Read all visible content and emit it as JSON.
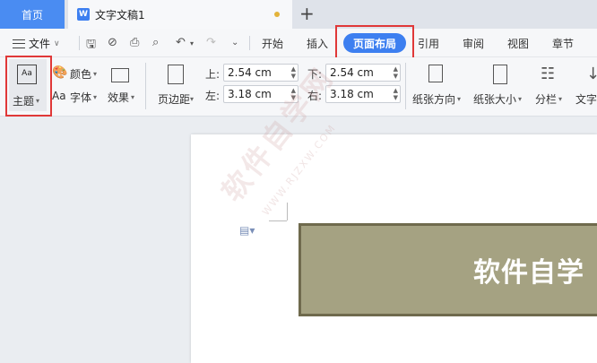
{
  "tabs": {
    "home": "首页",
    "doc_badge": "W",
    "doc_title": "文字文稿1",
    "plus": "+"
  },
  "menu": {
    "file": "文件",
    "tabs": [
      "开始",
      "插入",
      "页面布局",
      "引用",
      "审阅",
      "视图",
      "章节"
    ],
    "active_tab": "页面布局"
  },
  "ribbon": {
    "theme": "主题",
    "theme_icon_text": "Aa",
    "color": "颜色",
    "font_prefix": "Aa",
    "font": "字体",
    "effect": "效果",
    "margins": "页边距",
    "top_label": "上:",
    "top_value": "2.54 cm",
    "left_label": "左:",
    "left_value": "3.18 cm",
    "bottom_label": "下:",
    "bottom_value": "2.54 cm",
    "right_label": "右:",
    "right_value": "3.18 cm",
    "orientation": "纸张方向",
    "size": "纸张大小",
    "columns": "分栏",
    "text_dir": "文字"
  },
  "document": {
    "banner_text": "软件自学",
    "watermark": "软件自学网",
    "watermark_sub": "WWW.RJZXW.COM"
  },
  "colors": {
    "accent": "#3d7ff0",
    "highlight_box": "#e03838",
    "banner_fill": "#a5a282",
    "banner_border": "#6f6a4d"
  }
}
